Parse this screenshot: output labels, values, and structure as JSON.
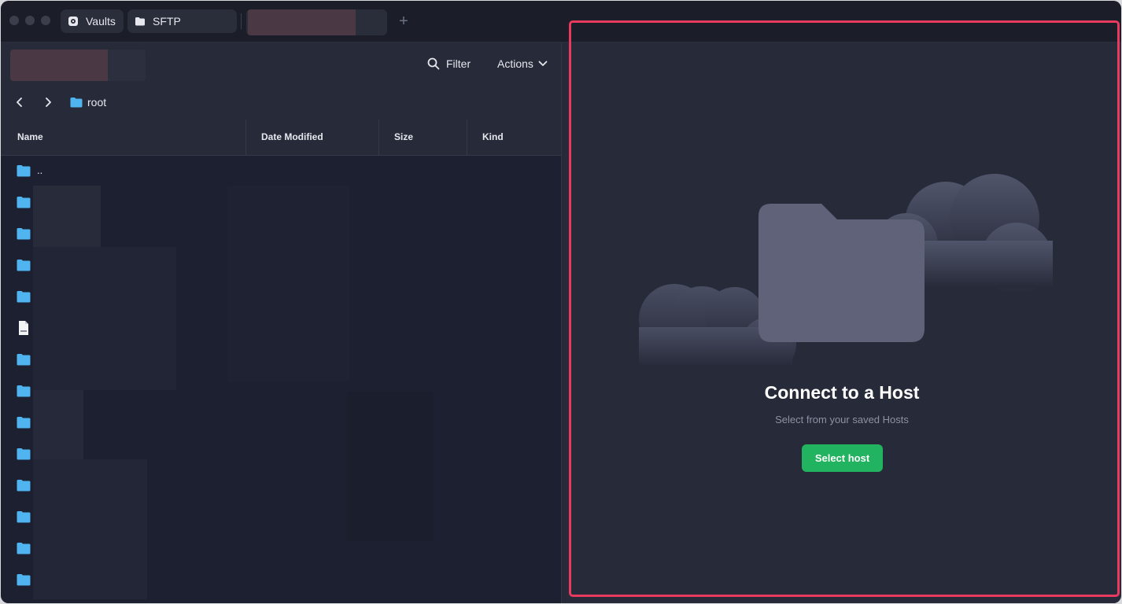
{
  "titlebar": {
    "tabs": [
      {
        "label": "Vaults",
        "icon": "vault-icon"
      },
      {
        "label": "SFTP",
        "icon": "folder-icon"
      }
    ],
    "new_tab_icon": "plus-icon"
  },
  "toolbar": {
    "filter_label": "Filter",
    "actions_label": "Actions"
  },
  "breadcrumb": {
    "root_label": "root"
  },
  "table": {
    "columns": [
      "Name",
      "Date Modified",
      "Size",
      "Kind"
    ],
    "rows": [
      {
        "name": "..",
        "type": "folder"
      },
      {
        "name": "",
        "type": "folder"
      },
      {
        "name": "",
        "type": "folder"
      },
      {
        "name": "",
        "type": "folder"
      },
      {
        "name": "",
        "type": "folder"
      },
      {
        "name": "",
        "type": "file"
      },
      {
        "name": "",
        "type": "folder"
      },
      {
        "name": "",
        "type": "folder"
      },
      {
        "name": "",
        "type": "folder"
      },
      {
        "name": "",
        "type": "folder"
      },
      {
        "name": "",
        "type": "folder"
      },
      {
        "name": "",
        "type": "folder"
      },
      {
        "name": "",
        "type": "folder"
      },
      {
        "name": "",
        "type": "folder"
      }
    ]
  },
  "empty_state": {
    "title": "Connect to a Host",
    "subtitle": "Select from your saved Hosts",
    "button_label": "Select host"
  },
  "colors": {
    "accent_green": "#21b35f",
    "highlight_border": "#e83a5f",
    "folder_blue": "#4fb4f0"
  }
}
